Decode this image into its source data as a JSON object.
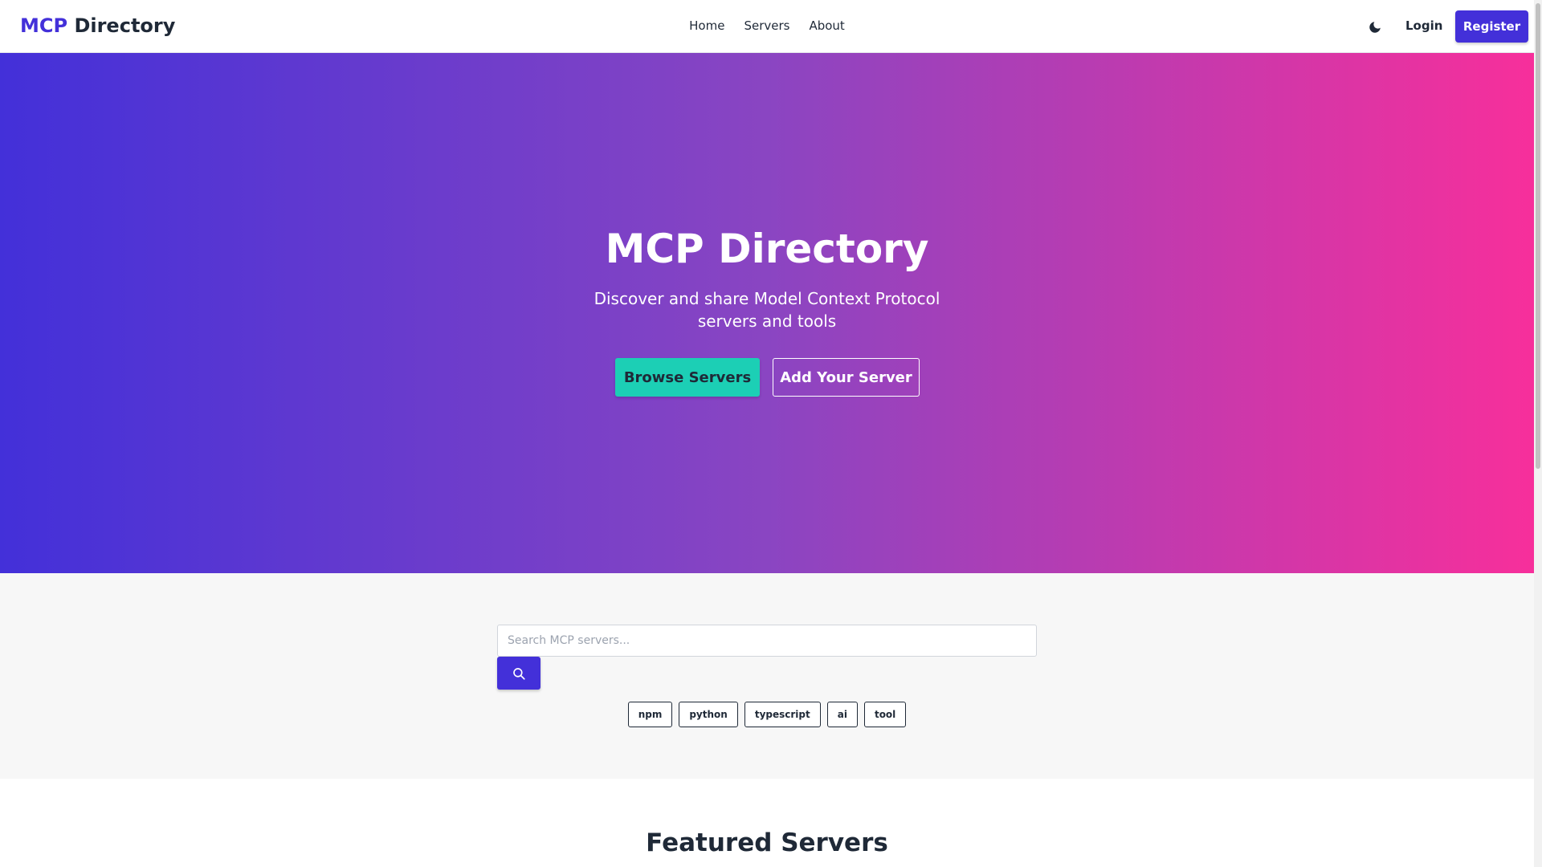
{
  "navbar": {
    "brand_accent": "MCP",
    "brand_rest": " Directory",
    "links": [
      {
        "label": "Home"
      },
      {
        "label": "Servers"
      },
      {
        "label": "About"
      }
    ],
    "theme_toggle_icon": "moon-icon",
    "login_label": "Login",
    "register_label": "Register"
  },
  "hero": {
    "title": "MCP Directory",
    "subtitle": "Discover and share Model Context Protocol servers and tools",
    "browse_label": "Browse Servers",
    "add_label": "Add Your Server"
  },
  "search": {
    "placeholder": "Search MCP servers...",
    "value": "",
    "button_icon": "search-icon",
    "tags": [
      "npm",
      "python",
      "typescript",
      "ai",
      "tool"
    ]
  },
  "featured": {
    "title": "Featured Servers"
  },
  "colors": {
    "primary": "#4330d9",
    "teal": "#1ccfb5",
    "gradient_start": "#4330d9",
    "gradient_mid": "#8a45c2",
    "gradient_end": "#f72f9b"
  }
}
